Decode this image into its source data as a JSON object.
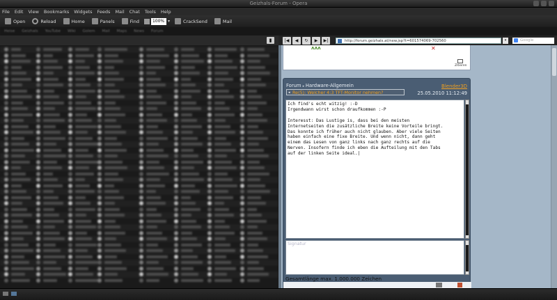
{
  "window": {
    "title": "Geizhals-Forum - Opera"
  },
  "menu": [
    "File",
    "Edit",
    "View",
    "Bookmarks",
    "Widgets",
    "Feeds",
    "Mail",
    "Chat",
    "Tools",
    "Help"
  ],
  "toolbar": {
    "open": "Open",
    "reload": "Reload",
    "home": "Home",
    "panels": "Panels",
    "find": "Find",
    "zoom": "100%",
    "crack": "CrackSend",
    "mail": "Mail"
  },
  "bookmarks": [
    "Heise",
    "Geizhals",
    "YouTube",
    "Wiki",
    "Golem",
    "Mail",
    "Maps",
    "News",
    "Forum"
  ],
  "right_nav": {
    "url": "http://forum.geizhals.at/new.jsp?t=601574069-702560",
    "search_placeholder": "Google"
  },
  "topbox": {
    "quote_label": "Zitieren"
  },
  "post": {
    "crumbs": [
      "Forum",
      "Hardware-Allgemein"
    ],
    "user": "Blender3D",
    "subject": "Re(5): Welcher 4:3 TFT-Monitor nehmen?",
    "date": "25.05.2010 11:12:49",
    "body": "Ich find's echt witzig! :-D\nIrgendwann wirst schon draufkommen :-P\n\nInteresst: Das Lustige is, dass bei den meisten\nInternetseiten die zusätzliche Breite keine Vorteile bringt.\nDas konnte ich früher auch nicht glauben. Aber viele Seiten\nhaben einfach eine fixe Breite. Und wenn nicht, dann geht\neinem das Lesen von ganz links nach ganz rechts auf die\nNerven. Insofern finde ich eben die Aufteilung mit den Tabs\nauf der linken Seite ideal.|",
    "signature_placeholder": "Signatur",
    "maxlen": "Gesamtlänge max. 1.000.000 Zeichen"
  },
  "colors": {
    "accent": "#f0a020",
    "page_bg": "#a5b7c8",
    "editor_bg": "#4a5d73"
  }
}
